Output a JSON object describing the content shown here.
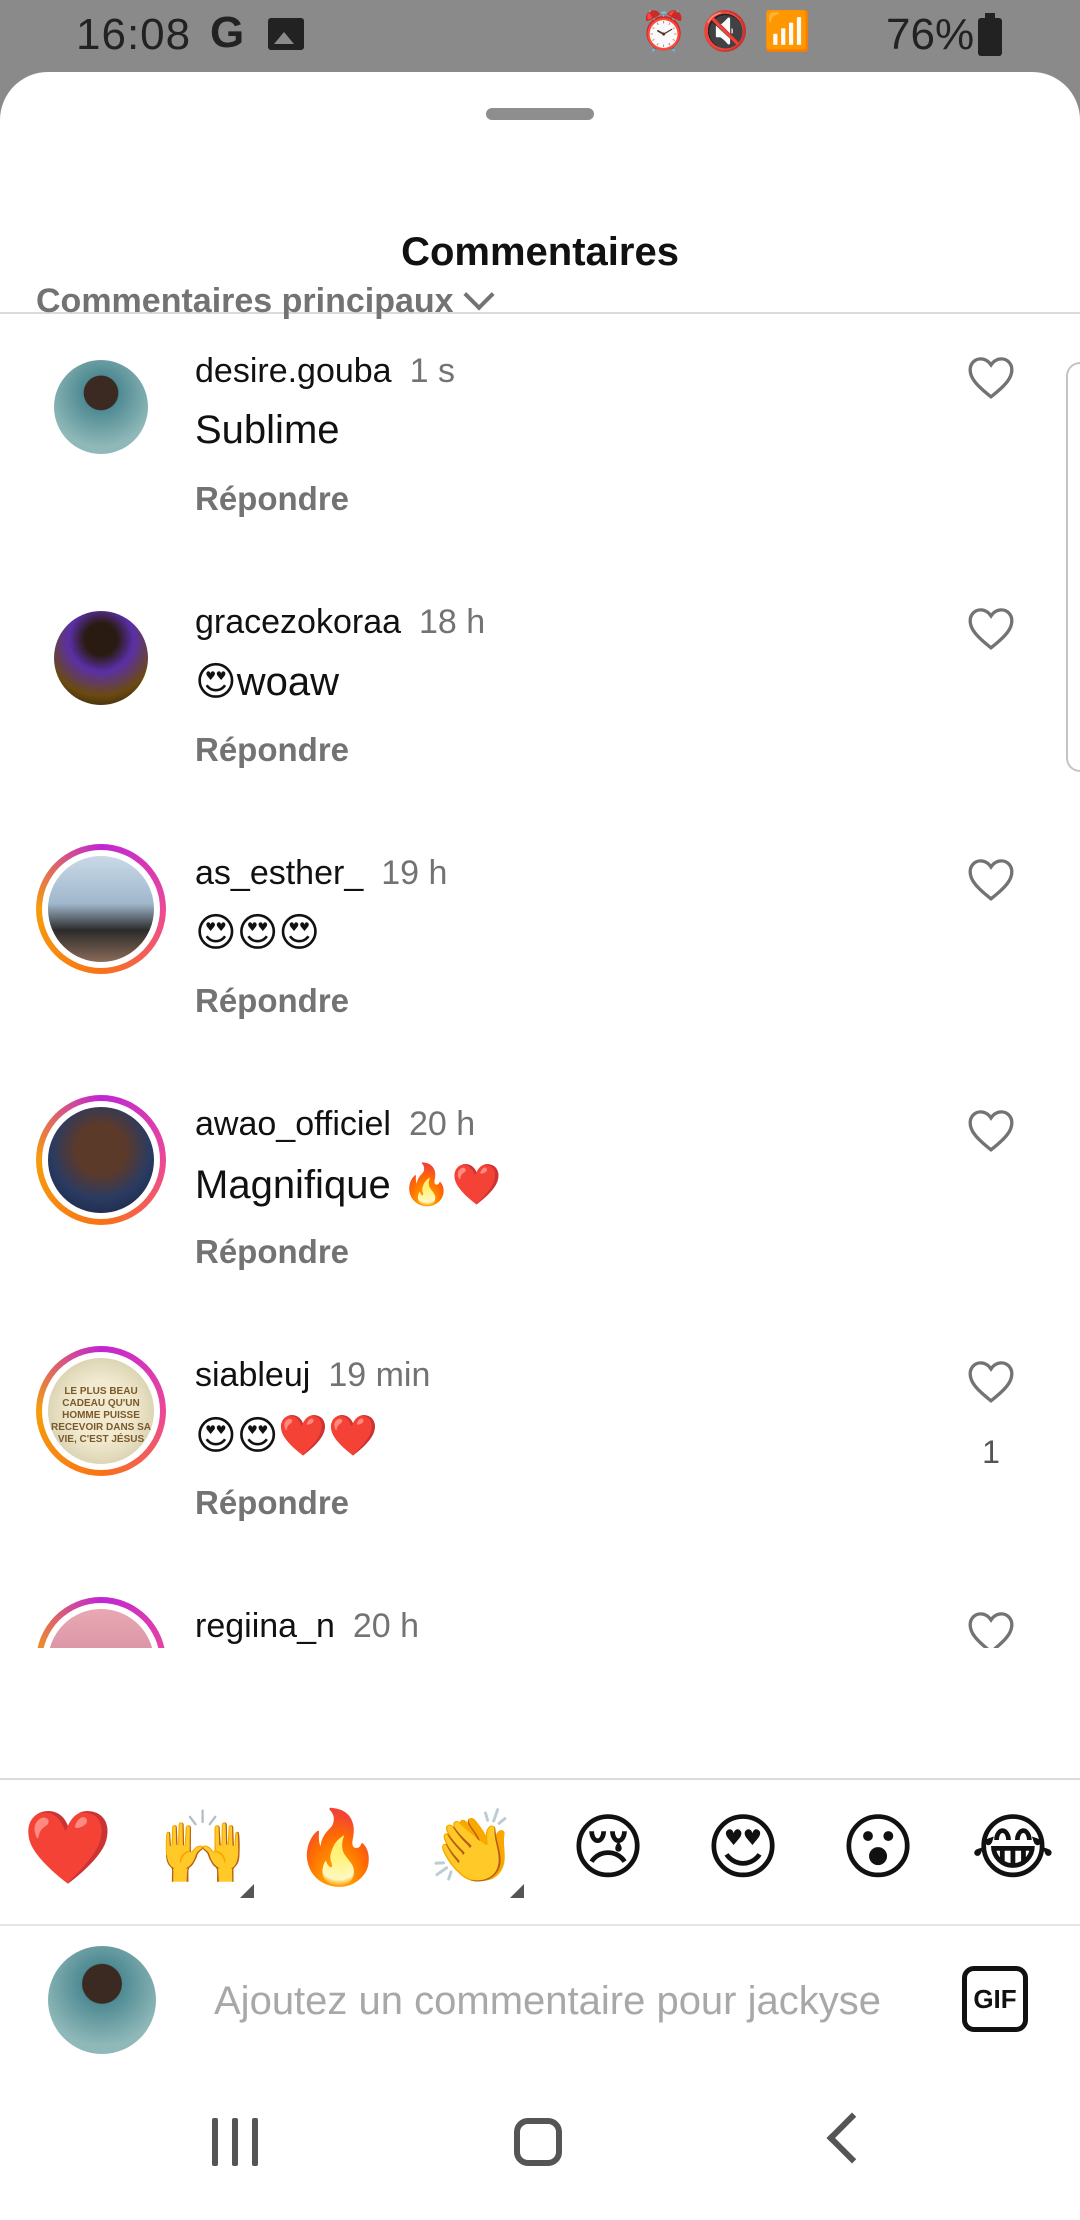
{
  "status_bar": {
    "time": "16:08",
    "g_label": "G",
    "icons_text": "⏰ 🔇 📶",
    "battery": "76%"
  },
  "sheet": {
    "title": "Commentaires",
    "sort_label": "Commentaires principaux"
  },
  "comments": [
    {
      "username": "desire.gouba",
      "time": "1 s",
      "text": "Sublime",
      "reply": "Répondre",
      "likes": ""
    },
    {
      "username": "gracezokoraa",
      "time": "18 h",
      "text": "😍woaw",
      "reply": "Répondre",
      "likes": ""
    },
    {
      "username": "as_esther_",
      "time": "19 h",
      "text": "😍😍😍",
      "reply": "Répondre",
      "likes": ""
    },
    {
      "username": "awao_officiel",
      "time": "20 h",
      "text": "Magnifique 🔥❤️",
      "reply": "Répondre",
      "likes": ""
    },
    {
      "username": "siableuj",
      "time": "19 min",
      "text": "😍😍❤️❤️",
      "reply": "Répondre",
      "likes": "1"
    },
    {
      "username": "regiina_n",
      "time": "20 h",
      "text": "",
      "reply": "",
      "likes": ""
    }
  ],
  "avatar_texts": {
    "siableuj": "LE PLUS BEAU CADEAU QU'UN HOMME PUISSE RECEVOIR DANS SA VIE, C'EST JÉSUS"
  },
  "emoji_bar": [
    "❤️",
    "🙌",
    "🔥",
    "👏",
    "😢",
    "😍",
    "😮",
    "😂"
  ],
  "input": {
    "placeholder": "Ajoutez un commentaire pour jackyse",
    "gif_label": "GIF"
  }
}
